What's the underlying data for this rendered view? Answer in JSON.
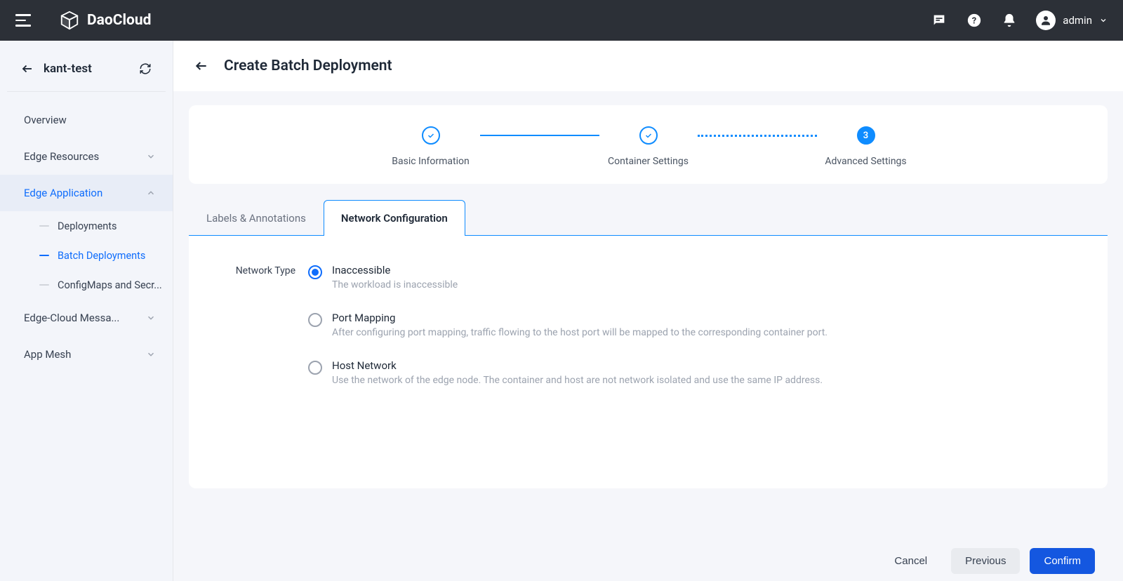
{
  "brand": "DaoCloud",
  "user": {
    "name": "admin"
  },
  "sidebar": {
    "workspace": "kant-test",
    "items": [
      {
        "label": "Overview",
        "expandable": false
      },
      {
        "label": "Edge Resources",
        "expandable": true
      },
      {
        "label": "Edge Application",
        "expandable": true,
        "active": true,
        "children": [
          {
            "label": "Deployments"
          },
          {
            "label": "Batch Deployments",
            "active": true
          },
          {
            "label": "ConfigMaps and Secr..."
          }
        ]
      },
      {
        "label": "Edge-Cloud Messa...",
        "expandable": true
      },
      {
        "label": "App Mesh",
        "expandable": true
      }
    ]
  },
  "page": {
    "title": "Create Batch Deployment"
  },
  "stepper": {
    "steps": [
      {
        "label": "Basic Information",
        "state": "done"
      },
      {
        "label": "Container Settings",
        "state": "done"
      },
      {
        "label": "Advanced Settings",
        "state": "active",
        "number": "3"
      }
    ]
  },
  "tabs": [
    {
      "label": "Labels & Annotations",
      "active": false
    },
    {
      "label": "Network Configuration",
      "active": true
    }
  ],
  "form": {
    "networkTypeLabel": "Network Type",
    "options": [
      {
        "title": "Inaccessible",
        "desc": "The workload is inaccessible",
        "selected": true
      },
      {
        "title": "Port Mapping",
        "desc": "After configuring port mapping, traffic flowing to the host port will be mapped to the corresponding container port.",
        "selected": false
      },
      {
        "title": "Host Network",
        "desc": "Use the network of the edge node. The container and host are not network isolated and use the same IP address.",
        "selected": false
      }
    ]
  },
  "footer": {
    "cancel": "Cancel",
    "previous": "Previous",
    "confirm": "Confirm"
  }
}
